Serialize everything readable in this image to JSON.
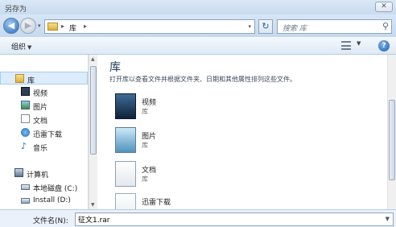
{
  "window": {
    "title": "另存为"
  },
  "address": {
    "crumb": "库",
    "separator": "▸"
  },
  "search": {
    "placeholder": "搜索 库"
  },
  "toolbar": {
    "organize_label": "组织"
  },
  "sidebar": {
    "items": [
      {
        "label": "库",
        "icon": "library-icon"
      },
      {
        "label": "视频",
        "icon": "video-icon"
      },
      {
        "label": "图片",
        "icon": "picture-icon"
      },
      {
        "label": "文档",
        "icon": "document-icon"
      },
      {
        "label": "迅雷下载",
        "icon": "download-icon"
      },
      {
        "label": "音乐",
        "icon": "music-icon"
      },
      {
        "label": "计算机",
        "icon": "computer-icon"
      },
      {
        "label": "本地磁盘 (C:)",
        "icon": "drive-icon"
      },
      {
        "label": "Install (D:)",
        "icon": "drive-icon"
      }
    ]
  },
  "main": {
    "heading": "库",
    "subtitle": "打开库以查看文件并根据文件夹、日期和其他属性排列这些文件。",
    "items": [
      {
        "name": "视频",
        "type": "库"
      },
      {
        "name": "图片",
        "type": "库"
      },
      {
        "name": "文档",
        "type": "库"
      },
      {
        "name": "迅雷下载",
        "type": ""
      }
    ]
  },
  "filename": {
    "label": "文件名(N):",
    "value": "征文1.rar"
  }
}
